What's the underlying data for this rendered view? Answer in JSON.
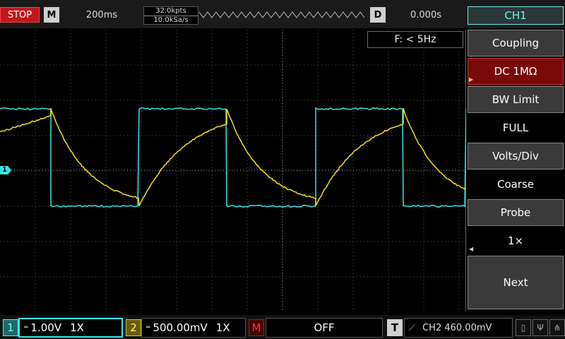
{
  "top": {
    "run_state": "STOP",
    "mode_letter": "M",
    "timebase": "200ms",
    "memory_depth": "32.0kpts",
    "sample_rate": "10.0kSa/s",
    "delay_letter": "D",
    "delay": "0.000s",
    "channel_title": "CH1"
  },
  "screen": {
    "frequency": "F: < 5Hz",
    "ch1_marker": "1"
  },
  "menu": {
    "coupling_label": "Coupling",
    "coupling_value": "DC 1MΩ",
    "bw_label": "BW Limit",
    "bw_value": "FULL",
    "volts_label": "Volts/Div",
    "volts_value": "Coarse",
    "probe_label": "Probe",
    "probe_value": "1×",
    "next_label": "Next"
  },
  "bottom": {
    "ch1_num": "1",
    "ch1_scale": "1.00V",
    "ch1_probe": "1X",
    "ch2_num": "2",
    "ch2_scale": "500.00mV",
    "ch2_probe": "1X",
    "math_letter": "M",
    "math_value": "OFF",
    "trigger_letter": "T",
    "trigger_info": "CH2 460.00mV"
  },
  "colors": {
    "ch1": "#39e6e6",
    "ch2": "#f0e020",
    "math": "#e02020",
    "stop": "#c0171a"
  },
  "icons": [
    "ramp-icon",
    "trigger-edge-icon",
    "usb-drive-icon",
    "usb-icon",
    "network-icon"
  ]
}
